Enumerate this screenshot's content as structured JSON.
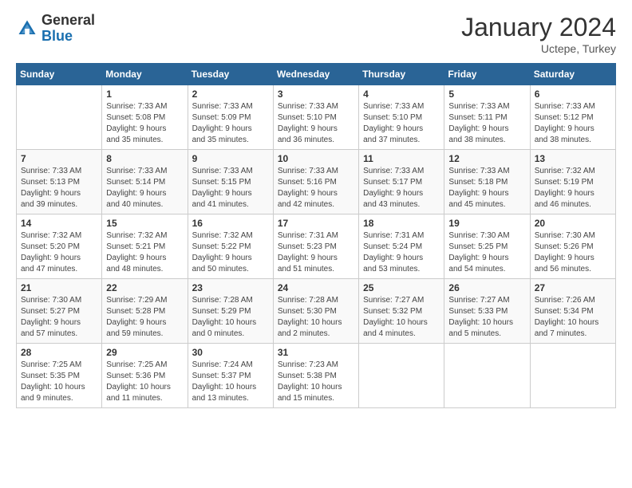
{
  "logo": {
    "general": "General",
    "blue": "Blue"
  },
  "title": "January 2024",
  "location": "Uctepe, Turkey",
  "weekdays": [
    "Sunday",
    "Monday",
    "Tuesday",
    "Wednesday",
    "Thursday",
    "Friday",
    "Saturday"
  ],
  "weeks": [
    [
      {
        "day": "",
        "info": ""
      },
      {
        "day": "1",
        "info": "Sunrise: 7:33 AM\nSunset: 5:08 PM\nDaylight: 9 hours\nand 35 minutes."
      },
      {
        "day": "2",
        "info": "Sunrise: 7:33 AM\nSunset: 5:09 PM\nDaylight: 9 hours\nand 35 minutes."
      },
      {
        "day": "3",
        "info": "Sunrise: 7:33 AM\nSunset: 5:10 PM\nDaylight: 9 hours\nand 36 minutes."
      },
      {
        "day": "4",
        "info": "Sunrise: 7:33 AM\nSunset: 5:10 PM\nDaylight: 9 hours\nand 37 minutes."
      },
      {
        "day": "5",
        "info": "Sunrise: 7:33 AM\nSunset: 5:11 PM\nDaylight: 9 hours\nand 38 minutes."
      },
      {
        "day": "6",
        "info": "Sunrise: 7:33 AM\nSunset: 5:12 PM\nDaylight: 9 hours\nand 38 minutes."
      }
    ],
    [
      {
        "day": "7",
        "info": "Sunrise: 7:33 AM\nSunset: 5:13 PM\nDaylight: 9 hours\nand 39 minutes."
      },
      {
        "day": "8",
        "info": "Sunrise: 7:33 AM\nSunset: 5:14 PM\nDaylight: 9 hours\nand 40 minutes."
      },
      {
        "day": "9",
        "info": "Sunrise: 7:33 AM\nSunset: 5:15 PM\nDaylight: 9 hours\nand 41 minutes."
      },
      {
        "day": "10",
        "info": "Sunrise: 7:33 AM\nSunset: 5:16 PM\nDaylight: 9 hours\nand 42 minutes."
      },
      {
        "day": "11",
        "info": "Sunrise: 7:33 AM\nSunset: 5:17 PM\nDaylight: 9 hours\nand 43 minutes."
      },
      {
        "day": "12",
        "info": "Sunrise: 7:33 AM\nSunset: 5:18 PM\nDaylight: 9 hours\nand 45 minutes."
      },
      {
        "day": "13",
        "info": "Sunrise: 7:32 AM\nSunset: 5:19 PM\nDaylight: 9 hours\nand 46 minutes."
      }
    ],
    [
      {
        "day": "14",
        "info": "Sunrise: 7:32 AM\nSunset: 5:20 PM\nDaylight: 9 hours\nand 47 minutes."
      },
      {
        "day": "15",
        "info": "Sunrise: 7:32 AM\nSunset: 5:21 PM\nDaylight: 9 hours\nand 48 minutes."
      },
      {
        "day": "16",
        "info": "Sunrise: 7:32 AM\nSunset: 5:22 PM\nDaylight: 9 hours\nand 50 minutes."
      },
      {
        "day": "17",
        "info": "Sunrise: 7:31 AM\nSunset: 5:23 PM\nDaylight: 9 hours\nand 51 minutes."
      },
      {
        "day": "18",
        "info": "Sunrise: 7:31 AM\nSunset: 5:24 PM\nDaylight: 9 hours\nand 53 minutes."
      },
      {
        "day": "19",
        "info": "Sunrise: 7:30 AM\nSunset: 5:25 PM\nDaylight: 9 hours\nand 54 minutes."
      },
      {
        "day": "20",
        "info": "Sunrise: 7:30 AM\nSunset: 5:26 PM\nDaylight: 9 hours\nand 56 minutes."
      }
    ],
    [
      {
        "day": "21",
        "info": "Sunrise: 7:30 AM\nSunset: 5:27 PM\nDaylight: 9 hours\nand 57 minutes."
      },
      {
        "day": "22",
        "info": "Sunrise: 7:29 AM\nSunset: 5:28 PM\nDaylight: 9 hours\nand 59 minutes."
      },
      {
        "day": "23",
        "info": "Sunrise: 7:28 AM\nSunset: 5:29 PM\nDaylight: 10 hours\nand 0 minutes."
      },
      {
        "day": "24",
        "info": "Sunrise: 7:28 AM\nSunset: 5:30 PM\nDaylight: 10 hours\nand 2 minutes."
      },
      {
        "day": "25",
        "info": "Sunrise: 7:27 AM\nSunset: 5:32 PM\nDaylight: 10 hours\nand 4 minutes."
      },
      {
        "day": "26",
        "info": "Sunrise: 7:27 AM\nSunset: 5:33 PM\nDaylight: 10 hours\nand 5 minutes."
      },
      {
        "day": "27",
        "info": "Sunrise: 7:26 AM\nSunset: 5:34 PM\nDaylight: 10 hours\nand 7 minutes."
      }
    ],
    [
      {
        "day": "28",
        "info": "Sunrise: 7:25 AM\nSunset: 5:35 PM\nDaylight: 10 hours\nand 9 minutes."
      },
      {
        "day": "29",
        "info": "Sunrise: 7:25 AM\nSunset: 5:36 PM\nDaylight: 10 hours\nand 11 minutes."
      },
      {
        "day": "30",
        "info": "Sunrise: 7:24 AM\nSunset: 5:37 PM\nDaylight: 10 hours\nand 13 minutes."
      },
      {
        "day": "31",
        "info": "Sunrise: 7:23 AM\nSunset: 5:38 PM\nDaylight: 10 hours\nand 15 minutes."
      },
      {
        "day": "",
        "info": ""
      },
      {
        "day": "",
        "info": ""
      },
      {
        "day": "",
        "info": ""
      }
    ]
  ]
}
